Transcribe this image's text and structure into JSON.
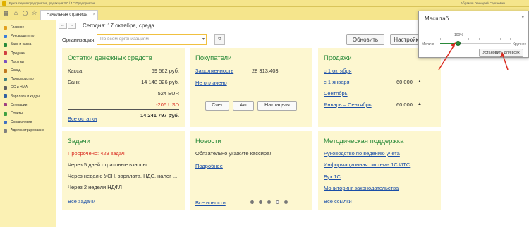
{
  "window": {
    "title": "Бухгалтерия предприятия, редакция 3.0 / 1С:Предприятие",
    "user": "Абрамов Геннадий Сергеевич"
  },
  "toolbar": {
    "tab_label": "Начальная страница",
    "icons": [
      "apps-icon",
      "home-icon",
      "history-icon",
      "star-icon"
    ]
  },
  "sidebar": {
    "items": [
      {
        "label": "Главное",
        "color": "#e0a020"
      },
      {
        "label": "Руководителю",
        "color": "#3b7dd8"
      },
      {
        "label": "Банк и касса",
        "color": "#2a8a3a"
      },
      {
        "label": "Продажи",
        "color": "#d04040"
      },
      {
        "label": "Покупки",
        "color": "#7a50c0"
      },
      {
        "label": "Склад",
        "color": "#c07a20"
      },
      {
        "label": "Производство",
        "color": "#408080"
      },
      {
        "label": "ОС и НМА",
        "color": "#606060"
      },
      {
        "label": "Зарплата и кадры",
        "color": "#3060a0"
      },
      {
        "label": "Операции",
        "color": "#a04080"
      },
      {
        "label": "Отчеты",
        "color": "#40a040"
      },
      {
        "label": "Справочники",
        "color": "#4070c0"
      },
      {
        "label": "Администрирование",
        "color": "#808080"
      }
    ]
  },
  "header": {
    "back": "←",
    "forward": "→",
    "title": "Сегодня: 17 октября, среда",
    "org_label": "Организация:",
    "org_placeholder": "По всем организациям",
    "refresh": "Обновить",
    "settings": "Настройка"
  },
  "cash": {
    "title": "Остатки денежных средств",
    "cash_label": "Касса:",
    "cash_value": "69 562 руб.",
    "bank_label": "Банк:",
    "bank_value1": "14 148 326 руб.",
    "bank_value2": "524 EUR",
    "bank_value3": "-206 USD",
    "total": "14 241 797 руб.",
    "all_link": "Все остатки"
  },
  "buyers": {
    "title": "Покупатели",
    "debt_link": "Задолженность",
    "debt_value": "28 313.403",
    "unpaid_link": "Не оплачено",
    "btn1": "Счет",
    "btn2": "Акт",
    "btn3": "Накладная"
  },
  "sales": {
    "title": "Продажи",
    "link1": "с 1 октября",
    "link2": "с 1 января",
    "value2": "60 000",
    "link3": "Сентябрь",
    "link4": "Январь – Сентябрь",
    "value4": "60 000",
    "trend": "▲"
  },
  "tasks": {
    "title": "Задачи",
    "overdue": "Просрочено: 429 задач",
    "t1": "Через 5 дней страховые взносы",
    "t2": "Через неделю УСН, зарплата, НДС, налог ...",
    "t3": "Через 2 недели НДФЛ",
    "all_link": "Все задачи"
  },
  "news": {
    "title": "Новости",
    "text": "Обязательно укажите кассира!",
    "more_link": "Подробнее",
    "all_link": "Все новости"
  },
  "support": {
    "title": "Методическая поддержка",
    "l1": "Руководство по ведению учета",
    "l2": "Информационная система 1С:ИТС",
    "l3": "Бух.1С",
    "l4": "Мониторинг законодательства",
    "all_link": "Все ссылки"
  },
  "scale_popup": {
    "title": "Масштаб",
    "close": "×",
    "smaller": "Мельче",
    "larger": "Крупнее",
    "percent": "100%",
    "level_fraction": 0.25,
    "set_all": "Установить для всех"
  }
}
